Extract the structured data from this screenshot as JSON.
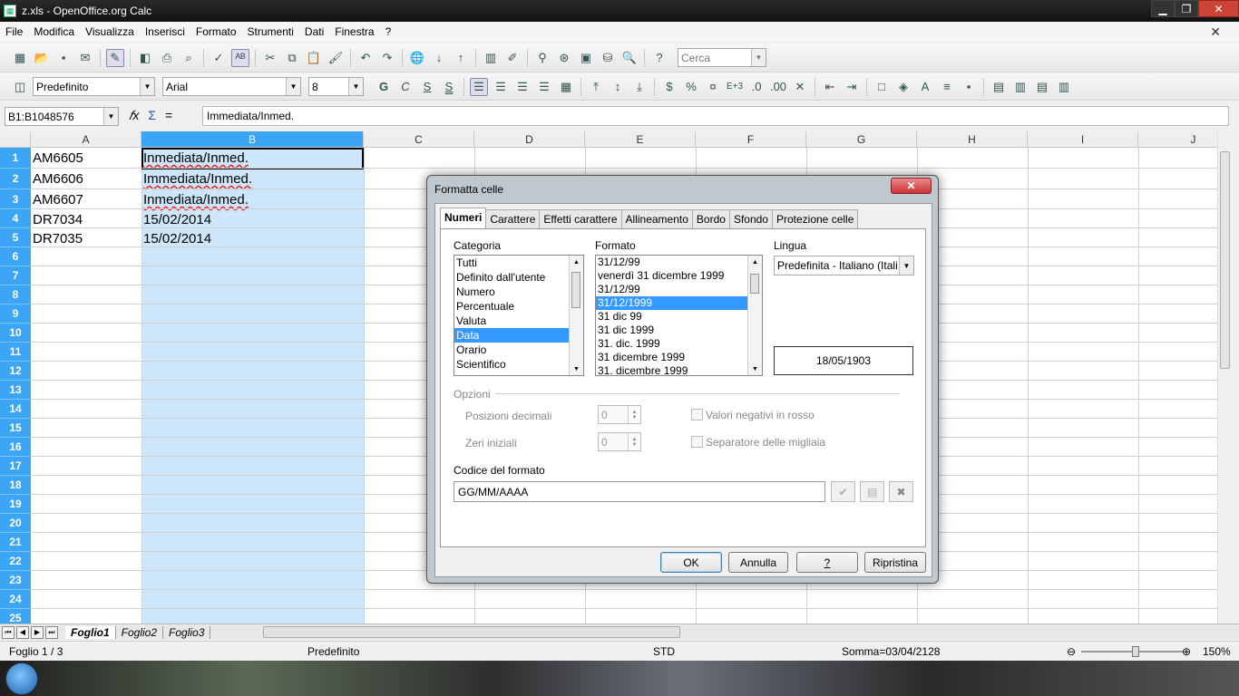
{
  "window": {
    "title": "z.xls - OpenOffice.org Calc"
  },
  "menu": [
    "File",
    "Modifica",
    "Visualizza",
    "Inserisci",
    "Formato",
    "Strumenti",
    "Dati",
    "Finestra",
    "?"
  ],
  "toolbar": {
    "search_placeholder": "Cerca",
    "style": "Predefinito",
    "font": "Arial",
    "size": "8"
  },
  "formula": {
    "namebox": "B1:B1048576",
    "content": "Immediata/Inmed."
  },
  "columns": [
    "A",
    "B",
    "C",
    "D",
    "E",
    "F",
    "G",
    "H",
    "I",
    "J"
  ],
  "rows": [
    "1",
    "2",
    "3",
    "4",
    "5",
    "6",
    "7",
    "8",
    "9",
    "10",
    "11",
    "12",
    "13",
    "14",
    "15",
    "16",
    "17",
    "18",
    "19",
    "20",
    "21",
    "22",
    "23",
    "24",
    "25"
  ],
  "cells": [
    {
      "a": "AM6605",
      "b": "Inmediata/Inmed."
    },
    {
      "a": "AM6606",
      "b": "Immediata/Inmed."
    },
    {
      "a": "AM6607",
      "b": "Inmediata/Inmed."
    },
    {
      "a": "DR7034",
      "b": "15/02/2014"
    },
    {
      "a": "DR7035",
      "b": "15/02/2014"
    }
  ],
  "sheets": [
    "Foglio1",
    "Foglio2",
    "Foglio3"
  ],
  "status": {
    "sheet": "Foglio 1 / 3",
    "style": "Predefinito",
    "mode": "STD",
    "sum": "Somma=03/04/2128",
    "zoom": "150%"
  },
  "dialog": {
    "title": "Formatta celle",
    "tabs": [
      "Numeri",
      "Carattere",
      "Effetti carattere",
      "Allineamento",
      "Bordo",
      "Sfondo",
      "Protezione celle"
    ],
    "category_label": "Categoria",
    "categories": [
      "Tutti",
      "Definito dall'utente",
      "Numero",
      "Percentuale",
      "Valuta",
      "Data",
      "Orario",
      "Scientifico"
    ],
    "format_label": "Formato",
    "formats": [
      "31/12/99",
      "venerdì 31 dicembre 1999",
      "31/12/99",
      "31/12/1999",
      "31 dic 99",
      "31 dic 1999",
      "31. dic. 1999",
      "31 dicembre 1999",
      "31. dicembre 1999"
    ],
    "language_label": "Lingua",
    "language": "Predefinita - Italiano (Itali",
    "preview": "18/05/1903",
    "options_label": "Opzioni",
    "decimals_label": "Posizioni decimali",
    "decimals": "0",
    "zeros_label": "Zeri iniziali",
    "zeros": "0",
    "negative_label": "Valori negativi in rosso",
    "thousands_label": "Separatore delle migliaia",
    "code_label": "Codice del formato",
    "code": "GG/MM/AAAA",
    "ok": "OK",
    "cancel": "Annulla",
    "help": "?",
    "reset": "Ripristina"
  }
}
